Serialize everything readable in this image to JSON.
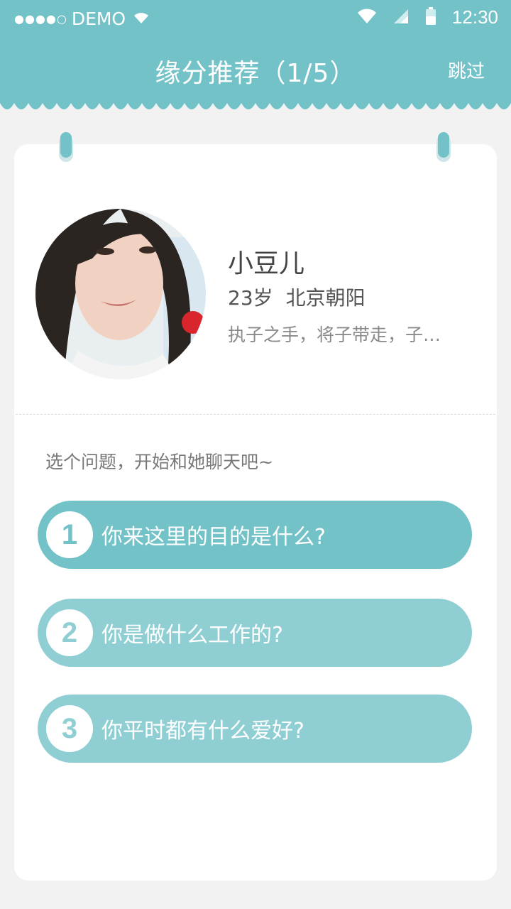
{
  "status_bar": {
    "signal_dots": "●●●●○",
    "carrier": "DEMO",
    "time": "12:30",
    "icons": [
      "wifi-icon",
      "cell-signal-icon",
      "battery-icon"
    ]
  },
  "header": {
    "title": "缘分推荐（1/5）",
    "skip_label": "跳过"
  },
  "profile": {
    "name": "小豆儿",
    "age": "23岁",
    "location": "北京朝阳",
    "motto": "执子之手，将子带走，子…"
  },
  "chat": {
    "prompt": "选个问题，开始和她聊天吧~",
    "questions": [
      {
        "number": "1",
        "text": "你来这里的目的是什么?"
      },
      {
        "number": "2",
        "text": "你是做什么工作的?"
      },
      {
        "number": "3",
        "text": "你平时都有什么爱好?"
      }
    ]
  },
  "colors": {
    "accent": "#72c2c8",
    "accent_light": "#8fcfd4",
    "background": "#f2f2f2",
    "card": "#ffffff"
  }
}
